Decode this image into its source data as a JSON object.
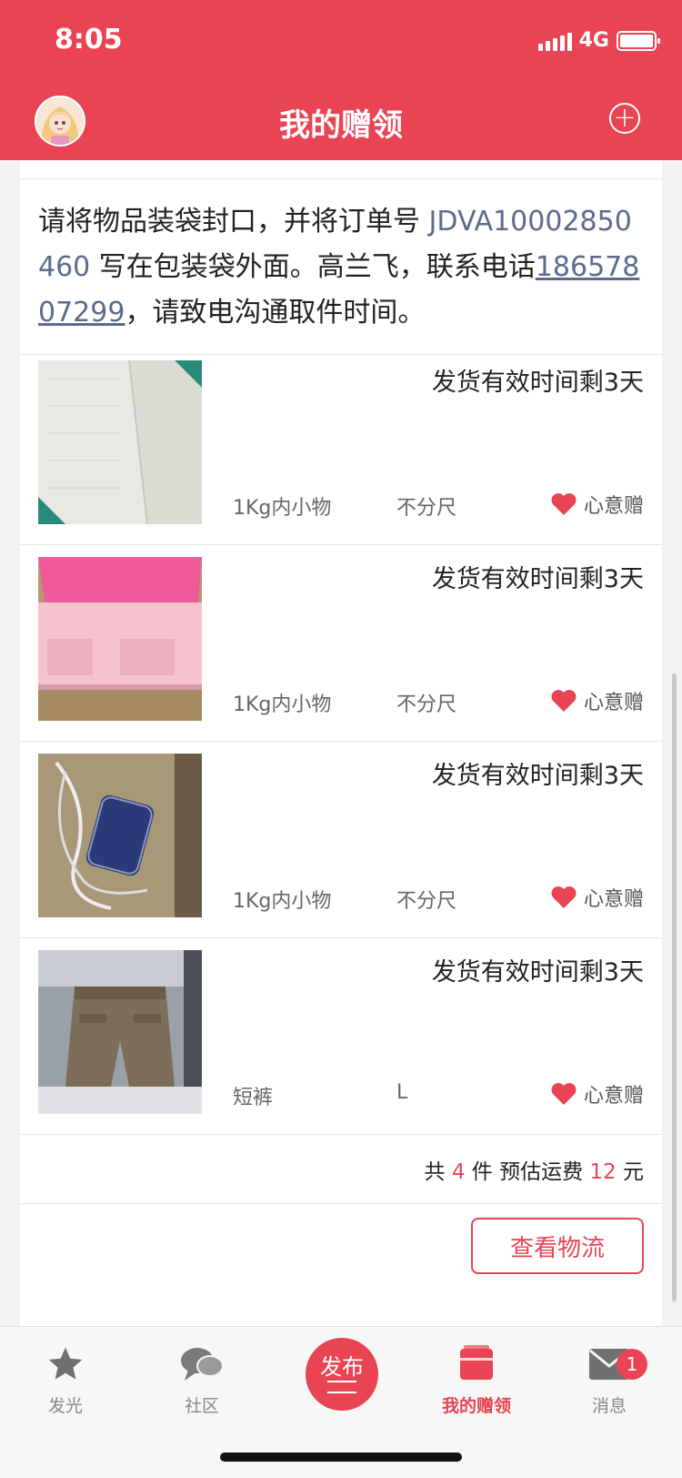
{
  "status_bar": {
    "time": "8:05",
    "network": "4G"
  },
  "header": {
    "title": "我的赠领"
  },
  "notice": {
    "text_before": "请将物品装袋封口，并将订单号 ",
    "order_no": "JDVA10002850460",
    "text_middle": " 写在包装袋外面。高兰飞，联系电话",
    "phone": "18657807299",
    "text_after": "，请致电沟通取件时间。"
  },
  "items": [
    {
      "deadline": "发货有效时间剩3天",
      "weight": "1Kg内小物",
      "size": "不分尺",
      "type": "心意赠",
      "image": "paper-towels"
    },
    {
      "deadline": "发货有效时间剩3天",
      "weight": "1Kg内小物",
      "size": "不分尺",
      "type": "心意赠",
      "image": "pink-box"
    },
    {
      "deadline": "发货有效时间剩3天",
      "weight": "1Kg内小物",
      "size": "不分尺",
      "type": "心意赠",
      "image": "charger"
    },
    {
      "deadline": "发货有效时间剩3天",
      "weight": "短裤",
      "size": "L",
      "type": "心意赠",
      "image": "shorts"
    }
  ],
  "summary": {
    "label_total": "共",
    "count": "4",
    "label_pieces": "件 预估运费",
    "fee": "12",
    "label_unit": "元"
  },
  "actions": {
    "track_label": "查看物流"
  },
  "tabbar": {
    "tabs": [
      {
        "label": "发光"
      },
      {
        "label": "社区"
      },
      {
        "label": "发布"
      },
      {
        "label": "我的赠领"
      },
      {
        "label": "消息",
        "badge": "1"
      }
    ]
  },
  "colors": {
    "accent": "#e84453",
    "link": "#5b6b8c"
  }
}
